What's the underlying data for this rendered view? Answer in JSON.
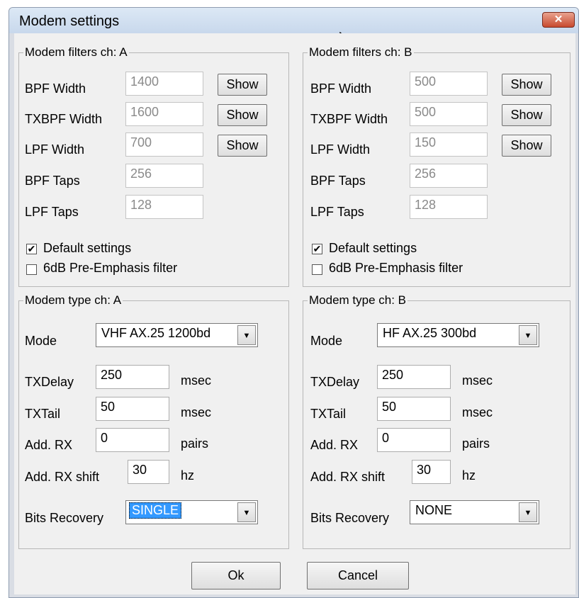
{
  "window": {
    "title": "Modem settings",
    "close_icon": "close-icon"
  },
  "filters_a": {
    "legend": "Modem filters ch: A",
    "bpf_width_label": "BPF Width",
    "bpf_width": "1400",
    "txbpf_width_label": "TXBPF Width",
    "txbpf_width": "1600",
    "lpf_width_label": "LPF Width",
    "lpf_width": "700",
    "bpf_taps_label": "BPF Taps",
    "bpf_taps": "256",
    "lpf_taps_label": "LPF Taps",
    "lpf_taps": "128",
    "show_label": "Show",
    "default_settings_label": "Default settings",
    "default_settings_checked": "✔",
    "preemphasis_label": "6dB Pre-Emphasis filter"
  },
  "filters_b": {
    "legend": "Modem filters ch: B",
    "bpf_width_label": "BPF Width",
    "bpf_width": "500",
    "txbpf_width_label": "TXBPF Width",
    "txbpf_width": "500",
    "lpf_width_label": "LPF Width",
    "lpf_width": "150",
    "bpf_taps_label": "BPF Taps",
    "bpf_taps": "256",
    "lpf_taps_label": "LPF Taps",
    "lpf_taps": "128",
    "show_label": "Show",
    "default_settings_label": "Default settings",
    "default_settings_checked": "✔",
    "preemphasis_label": "6dB Pre-Emphasis filter"
  },
  "type_a": {
    "legend": "Modem type ch: A",
    "mode_label": "Mode",
    "mode": "VHF AX.25 1200bd",
    "txdelay_label": "TXDelay",
    "txdelay": "250",
    "txdelay_unit": "msec",
    "txtail_label": "TXTail",
    "txtail": "50",
    "txtail_unit": "msec",
    "addrx_label": "Add. RX",
    "addrx": "0",
    "addrx_unit": "pairs",
    "addrx_shift_label": "Add. RX shift",
    "addrx_shift": "30",
    "addrx_shift_unit": "hz",
    "bits_recovery_label": "Bits Recovery",
    "bits_recovery": "SINGLE"
  },
  "type_b": {
    "legend": "Modem type ch: B",
    "mode_label": "Mode",
    "mode": "HF AX.25 300bd",
    "txdelay_label": "TXDelay",
    "txdelay": "250",
    "txdelay_unit": "msec",
    "txtail_label": "TXTail",
    "txtail": "50",
    "txtail_unit": "msec",
    "addrx_label": "Add. RX",
    "addrx": "0",
    "addrx_unit": "pairs",
    "addrx_shift_label": "Add. RX shift",
    "addrx_shift": "30",
    "addrx_shift_unit": "hz",
    "bits_recovery_label": "Bits Recovery",
    "bits_recovery": "NONE"
  },
  "buttons": {
    "ok": "Ok",
    "cancel": "Cancel"
  },
  "icons": {
    "dropdown": "▼"
  },
  "colors": {
    "selection": "#3399ff",
    "close": "#c84a2f",
    "title_bg": "#dce8f5"
  }
}
